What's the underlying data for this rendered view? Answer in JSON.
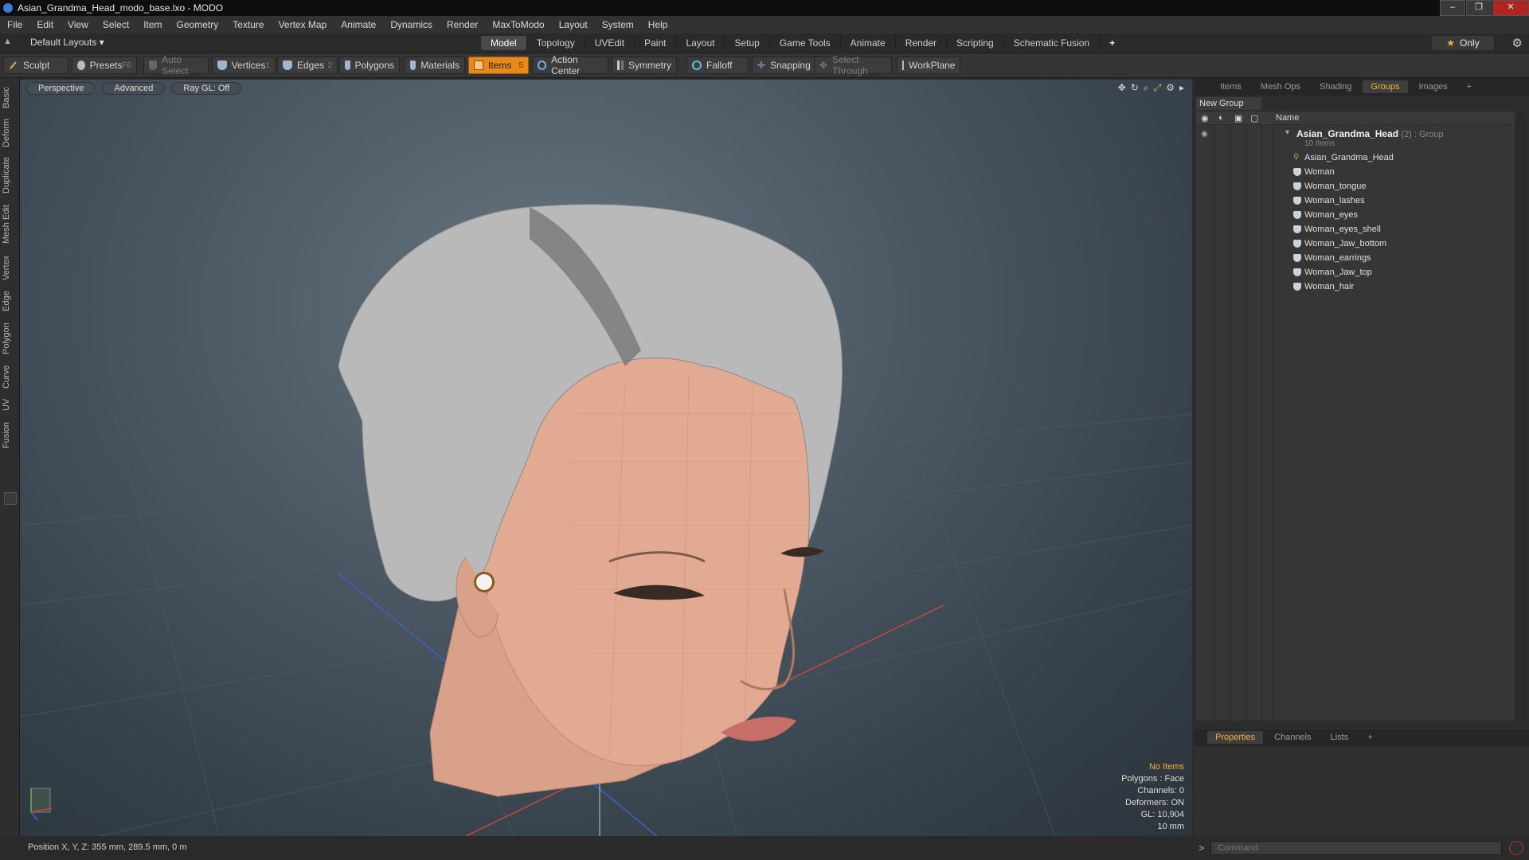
{
  "window": {
    "title": "Asian_Grandma_Head_modo_base.lxo - MODO",
    "controls": [
      "–",
      "❐",
      "✕"
    ]
  },
  "menubar": {
    "items": [
      "File",
      "Edit",
      "View",
      "Select",
      "Item",
      "Geometry",
      "Texture",
      "Vertex Map",
      "Animate",
      "Dynamics",
      "Render",
      "MaxToModo",
      "Layout",
      "System",
      "Help"
    ]
  },
  "layoutbar": {
    "layout_select": "Default Layouts ▾",
    "tabs": [
      "Model",
      "Topology",
      "UVEdit",
      "Paint",
      "Layout",
      "Setup",
      "Game Tools",
      "Animate",
      "Render",
      "Scripting",
      "Schematic Fusion"
    ],
    "active_tab": "Model",
    "add_tab": "+",
    "only_label": "Only"
  },
  "toolbar": {
    "sculpt": "Sculpt",
    "presets": "Presets",
    "presets_key": "F6",
    "auto_select": "Auto Select",
    "vertices": "Vertices",
    "vertices_key": "1",
    "edges": "Edges",
    "edges_key": "2",
    "polygons": "Polygons",
    "materials": "Materials",
    "items": "Items",
    "items_key": "5",
    "action_center": "Action Center",
    "symmetry": "Symmetry",
    "falloff": "Falloff",
    "snapping": "Snapping",
    "select_through": "Select Through",
    "workplane": "WorkPlane"
  },
  "left_tabs": [
    "Basic",
    "Deform",
    "Duplicate",
    "Mesh Edit",
    "Vertex",
    "Edge",
    "Polygon",
    "Curve",
    "UV",
    "Fusion"
  ],
  "viewport": {
    "view": "Perspective",
    "mode": "Advanced",
    "raygl": "Ray GL: Off",
    "info": {
      "no_items": "No Items",
      "polygons": "Polygons : Face",
      "channels": "Channels: 0",
      "deformers": "Deformers: ON",
      "gl": "GL: 10,904",
      "scale": "10 mm"
    }
  },
  "right_panel": {
    "tabs": [
      "Items",
      "Mesh Ops",
      "Shading",
      "Groups",
      "Images"
    ],
    "active_tab": "Groups",
    "add_tab": "+",
    "new_group": "New Group",
    "column_name": "Name",
    "group": {
      "name": "Asian_Grandma_Head",
      "suffix": "(2) : Group",
      "count": "10 Items"
    },
    "items": [
      {
        "label": "Asian_Grandma_Head",
        "kind": "locator"
      },
      {
        "label": "Woman",
        "kind": "mesh"
      },
      {
        "label": "Woman_tongue",
        "kind": "mesh"
      },
      {
        "label": "Woman_lashes",
        "kind": "mesh"
      },
      {
        "label": "Woman_eyes",
        "kind": "mesh"
      },
      {
        "label": "Woman_eyes_shell",
        "kind": "mesh"
      },
      {
        "label": "Woman_Jaw_bottom",
        "kind": "mesh"
      },
      {
        "label": "Woman_earrings",
        "kind": "mesh"
      },
      {
        "label": "Woman_Jaw_top",
        "kind": "mesh"
      },
      {
        "label": "Woman_hair",
        "kind": "mesh"
      }
    ],
    "props_tabs": [
      "Properties",
      "Channels",
      "Lists"
    ],
    "props_active": "Properties"
  },
  "statusbar": {
    "position": "Position X, Y, Z:  355 mm, 289.5 mm, 0 m"
  },
  "command": {
    "prompt": ">",
    "placeholder": "Command"
  }
}
